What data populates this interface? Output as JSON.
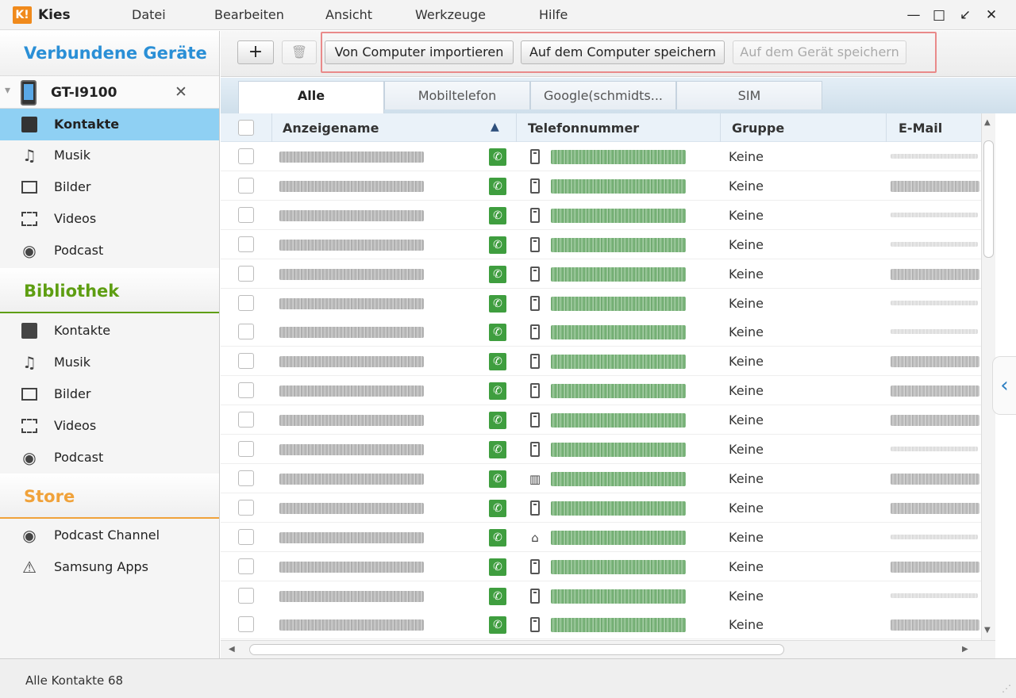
{
  "app": {
    "logo": "K!",
    "title": "Kies"
  },
  "menu": [
    "Datei",
    "Bearbeiten",
    "Ansicht",
    "Werkzeuge",
    "Hilfe"
  ],
  "window_buttons": {
    "minimize": "—",
    "maximize": "□",
    "restore": "↙",
    "close": "✕"
  },
  "sidebar": {
    "connected_title": "Verbundene Geräte",
    "device": {
      "name": "GT-I9100",
      "remove": "✕",
      "expand": "▾"
    },
    "device_items": [
      {
        "label": "Kontakte",
        "icon": "contacts-icon"
      },
      {
        "label": "Musik",
        "icon": "music-icon"
      },
      {
        "label": "Bilder",
        "icon": "pictures-icon"
      },
      {
        "label": "Videos",
        "icon": "videos-icon"
      },
      {
        "label": "Podcast",
        "icon": "podcast-icon"
      }
    ],
    "library_title": "Bibliothek",
    "library_items": [
      {
        "label": "Kontakte",
        "icon": "contacts-icon"
      },
      {
        "label": "Musik",
        "icon": "music-icon"
      },
      {
        "label": "Bilder",
        "icon": "pictures-icon"
      },
      {
        "label": "Videos",
        "icon": "videos-icon"
      },
      {
        "label": "Podcast",
        "icon": "podcast-icon"
      }
    ],
    "store_title": "Store",
    "store_items": [
      {
        "label": "Podcast Channel",
        "icon": "podcast-icon"
      },
      {
        "label": "Samsung Apps",
        "icon": "samsung-apps-icon"
      }
    ],
    "colors": {
      "connected": "#2a8fd6",
      "library": "#5e9e12",
      "store": "#f0a23a",
      "active": "#8fd0f3"
    }
  },
  "toolbar": {
    "add": "+",
    "delete": "🗑",
    "import_label": "Von Computer importieren",
    "save_computer_label": "Auf dem Computer speichern",
    "save_device_label": "Auf dem Gerät speichern"
  },
  "tabs": [
    "Alle",
    "Mobiltelefon",
    "Google(schmidts...",
    "SIM"
  ],
  "columns": {
    "name": "Anzeigename",
    "sort": "▲",
    "phone": "Telefonnummer",
    "group": "Gruppe",
    "email": "E-Mail"
  },
  "rows": [
    {
      "type": "mobile",
      "group": "Keine",
      "email": "short"
    },
    {
      "type": "mobile",
      "group": "Keine",
      "email": "long"
    },
    {
      "type": "mobile",
      "group": "Keine",
      "email": "short"
    },
    {
      "type": "mobile",
      "group": "Keine",
      "email": "short"
    },
    {
      "type": "mobile",
      "group": "Keine",
      "email": "long"
    },
    {
      "type": "mobile",
      "group": "Keine",
      "email": "short"
    },
    {
      "type": "mobile",
      "group": "Keine",
      "email": "short"
    },
    {
      "type": "mobile",
      "group": "Keine",
      "email": "long"
    },
    {
      "type": "mobile",
      "group": "Keine",
      "email": "long"
    },
    {
      "type": "mobile",
      "group": "Keine",
      "email": "long"
    },
    {
      "type": "mobile",
      "group": "Keine",
      "email": "short"
    },
    {
      "type": "work",
      "group": "Keine",
      "email": "long"
    },
    {
      "type": "mobile",
      "group": "Keine",
      "email": "long"
    },
    {
      "type": "home",
      "group": "Keine",
      "email": "short"
    },
    {
      "type": "mobile",
      "group": "Keine",
      "email": "long"
    },
    {
      "type": "mobile",
      "group": "Keine",
      "email": "short"
    },
    {
      "type": "mobile",
      "group": "Keine",
      "email": "long"
    }
  ],
  "icons": {
    "phone": "✆",
    "work": "▥",
    "home": "⌂",
    "collapse": "‹"
  },
  "status": {
    "text": "Alle Kontakte 68"
  }
}
